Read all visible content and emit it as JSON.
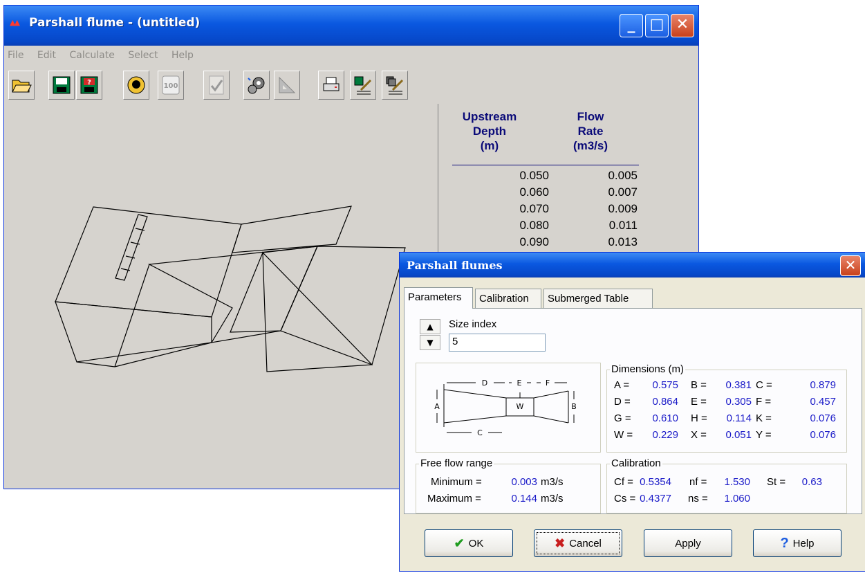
{
  "window": {
    "title": "Parshall flume - (untitled)",
    "menu": [
      "File",
      "Edit",
      "Calculate",
      "Select",
      "Help"
    ]
  },
  "table": {
    "col1_header": [
      "Upstream",
      "Depth",
      "(m)"
    ],
    "col2_header": [
      "Flow",
      "Rate",
      "(m3/s)"
    ],
    "rows": [
      [
        "0.050",
        "0.005"
      ],
      [
        "0.060",
        "0.007"
      ],
      [
        "0.070",
        "0.009"
      ],
      [
        "0.080",
        "0.011"
      ],
      [
        "0.090",
        "0.013"
      ]
    ]
  },
  "dialog": {
    "title": "Parshall flumes",
    "tabs": [
      "Parameters",
      "Calibration",
      "Submerged Table"
    ],
    "size_index_label": "Size index",
    "size_index_value": "5",
    "diagram_labels": {
      "d": "D",
      "e": "E",
      "f": "F",
      "a": "A",
      "w": "W",
      "b": "B",
      "c": "C"
    },
    "dimensions_title": "Dimensions (m)",
    "dimensions": [
      [
        [
          "A =",
          "0.575"
        ],
        [
          "B =",
          "0.381"
        ],
        [
          "C =",
          "0.879"
        ]
      ],
      [
        [
          "D =",
          "0.864"
        ],
        [
          "E =",
          "0.305"
        ],
        [
          "F =",
          "0.457"
        ]
      ],
      [
        [
          "G =",
          "0.610"
        ],
        [
          "H =",
          "0.114"
        ],
        [
          "K =",
          "0.076"
        ]
      ],
      [
        [
          "W =",
          "0.229"
        ],
        [
          "X =",
          "0.051"
        ],
        [
          "Y =",
          "0.076"
        ]
      ]
    ],
    "free_flow_title": "Free flow range",
    "min_label": "Minimum =",
    "min_value": "0.003",
    "max_label": "Maximum =",
    "max_value": "0.144",
    "unit": "m3/s",
    "calibration_title": "Calibration",
    "cf_label": "Cf =",
    "cf_value": "0.5354",
    "nf_label": "nf =",
    "nf_value": "1.530",
    "st_label": "St =",
    "st_value": "0.63",
    "cs_label": "Cs =",
    "cs_value": "0.4377",
    "ns_label": "ns =",
    "ns_value": "1.060",
    "buttons": {
      "ok": "OK",
      "cancel": "Cancel",
      "apply": "Apply",
      "help": "Help"
    }
  },
  "colors": {
    "accent": "#0a58e0",
    "value_blue": "#1a1ac8",
    "header_navy": "#0a0a78"
  }
}
